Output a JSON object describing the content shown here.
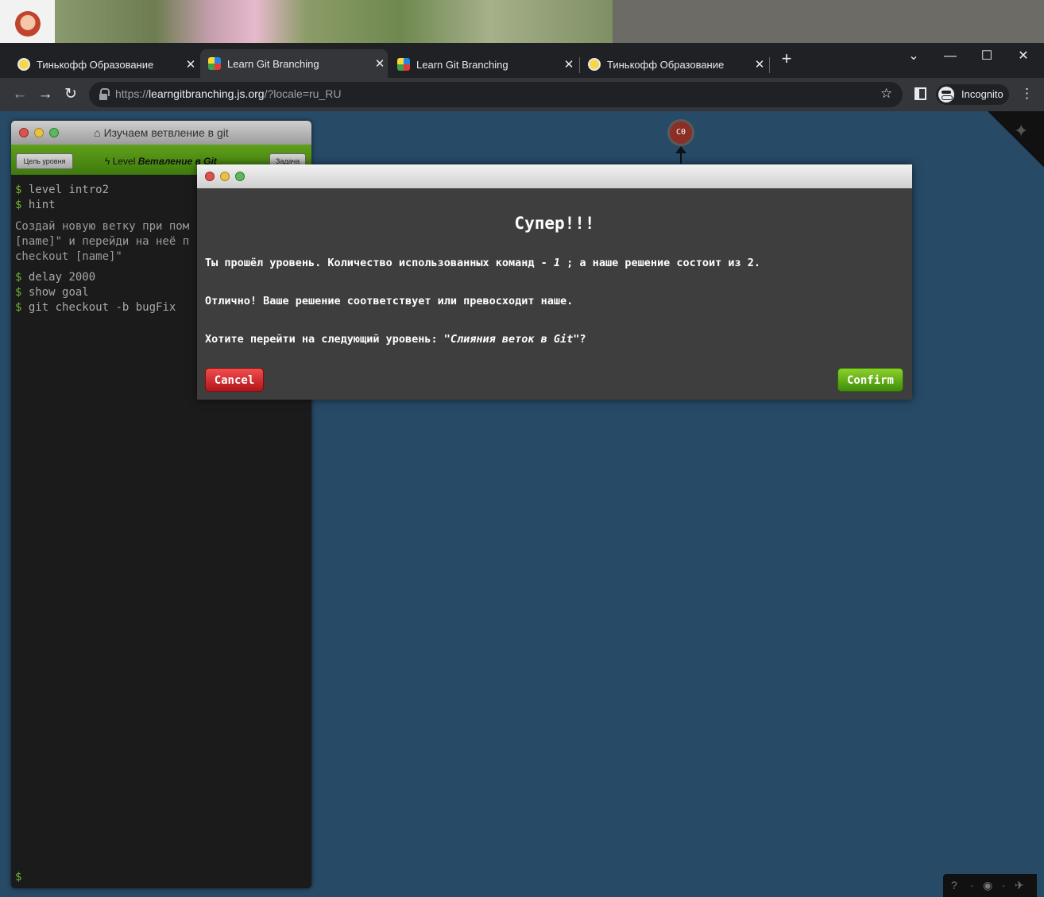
{
  "browser": {
    "tabs": [
      {
        "title": "Тинькофф Образование",
        "favicon": "tinkoff-icon"
      },
      {
        "title": "Learn Git Branching",
        "favicon": "git-branching-icon",
        "active": true
      },
      {
        "title": "Learn Git Branching",
        "favicon": "git-branching-icon"
      },
      {
        "title": "Тинькофф Образование",
        "favicon": "tinkoff-icon"
      }
    ],
    "url_prefix": "https://",
    "url_host": "learngitbranching.js.org",
    "url_path": "/?locale=ru_RU",
    "incognito_label": "Incognito"
  },
  "terminal": {
    "title": "Изучаем ветвление в git",
    "goal_button": "Цель уровня",
    "task_button": "Задача",
    "level_prefix": "Level",
    "level_name": "Ветвление в Git",
    "lines": [
      "level intro2",
      "hint"
    ],
    "hint_text": "Создай новую ветку при пом\n[name]\" и перейди на неё п\ncheckout [name]\"",
    "lines2": [
      "delay 2000",
      "show goal",
      "git checkout -b bugFix"
    ],
    "prompt": "$"
  },
  "visualization": {
    "commit_label": "C0",
    "commit_color": "#8b2e25"
  },
  "modal": {
    "title": "Супер!!!",
    "line1_a": "Ты прошёл уровень. Количество использованных команд - ",
    "line1_num": "1",
    "line1_b": " ; а наше решение состоит из 2.",
    "line2": "Отлично! Ваше решение соответствует или превосходит наше.",
    "line3_a": "Хотите перейти на следующий уровень: ",
    "line3_level": "\"Слияния веток в Git\"",
    "line3_b": "?",
    "cancel_label": "Cancel",
    "confirm_label": "Confirm"
  },
  "colors": {
    "page_bg": "#274a66",
    "cancel": "#d42a2f",
    "confirm": "#5fae18",
    "terminal_bar": "#4a8a13"
  }
}
